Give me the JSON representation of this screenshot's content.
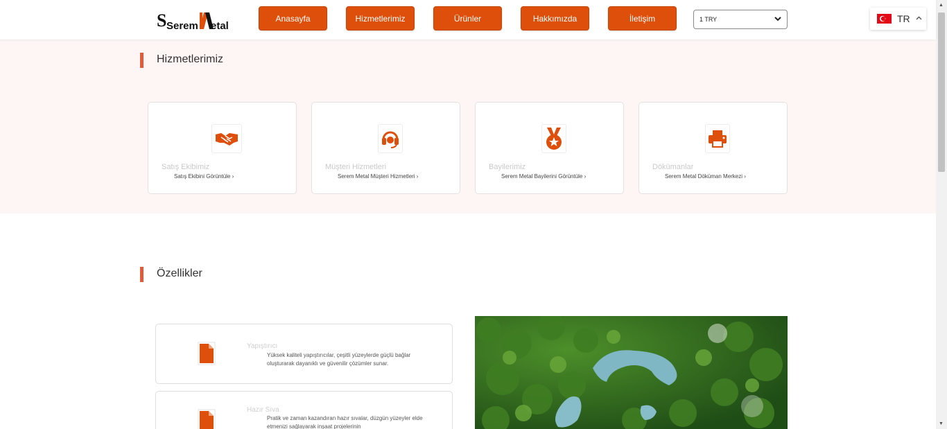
{
  "header": {
    "logo_text_a": "Serem",
    "logo_text_b": "Metal",
    "nav": [
      {
        "label": "Anasayfa"
      },
      {
        "label": "Hizmetlerimiz"
      },
      {
        "label": "Ürünler"
      },
      {
        "label": "Hakkımızda"
      },
      {
        "label": "İletişim"
      }
    ],
    "currency": {
      "selected": "1 TRY"
    },
    "language": {
      "code": "TR",
      "flag": "turkey-flag-icon"
    }
  },
  "services": {
    "title": "Hizmetlerimiz",
    "cards": [
      {
        "title": "Satış Ekibimiz",
        "link": "Satış Ekibini Görüntüle ›",
        "icon": "handshake-icon"
      },
      {
        "title": "Müşteri Hizmetleri",
        "link": "Serem Metal Müşteri Hizmetleri ›",
        "icon": "headset-icon"
      },
      {
        "title": "Bayilerimiz",
        "link": "Serem Metal Bayilerini Görüntüle ›",
        "icon": "medal-icon"
      },
      {
        "title": "Dökümanlar",
        "link": "Serem Metal Döküman Merkezi ›",
        "icon": "printer-icon"
      }
    ]
  },
  "features": {
    "title": "Özellikler",
    "items": [
      {
        "title": "Yapıştırıcı",
        "description": "Yüksek kaliteli yapıştırıcılar, çeşitli yüzeylerde güçlü bağlar oluşturarak dayanıklı ve güvenilir çözümler sunar.",
        "icon": "document-icon"
      },
      {
        "title": "Hazır Sıva",
        "description": "Pratik ve zaman kazandıran hazır sıvalar, düzgün yüzeyler elde etmenizi sağlayarak inşaat projelerinin",
        "icon": "document-icon"
      }
    ]
  },
  "colors": {
    "accent": "#dd4f0a",
    "section_bar": "#e05b3a",
    "services_bg": "#fdf6f4"
  }
}
